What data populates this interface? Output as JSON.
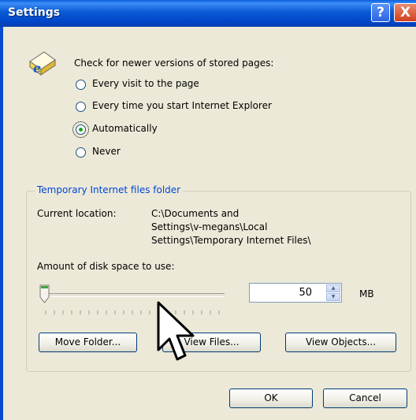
{
  "window": {
    "title": "Settings"
  },
  "title_buttons": {
    "help": "?",
    "close": "X"
  },
  "check_section": {
    "prompt": "Check for newer versions of stored pages:",
    "options": [
      {
        "label": "Every visit to the page",
        "checked": false
      },
      {
        "label": "Every time you start Internet Explorer",
        "checked": false
      },
      {
        "label": "Automatically",
        "checked": true
      },
      {
        "label": "Never",
        "checked": false
      }
    ]
  },
  "temp_folder": {
    "group_title": "Temporary Internet files folder",
    "current_location_label": "Current location:",
    "path_lines": [
      "C:\\Documents and",
      "Settings\\v-megans\\Local",
      "Settings\\Temporary Internet Files\\"
    ],
    "disk_space_label": "Amount of disk space to use:",
    "disk_space_value": "50",
    "unit": "MB",
    "slider_level_fraction": 0.0,
    "buttons": {
      "move_folder": "Move Folder...",
      "view_files": "View Files...",
      "view_objects": "View Objects..."
    }
  },
  "footer": {
    "ok": "OK",
    "cancel": "Cancel"
  },
  "colors": {
    "title_bar": "#0a5ad4",
    "dialog_bg": "#ece9d8",
    "group_title": "#0046d5",
    "button_border": "#003c74"
  },
  "icons": {
    "app": "ie-page-icon",
    "cursor": "mouse-pointer-icon"
  }
}
